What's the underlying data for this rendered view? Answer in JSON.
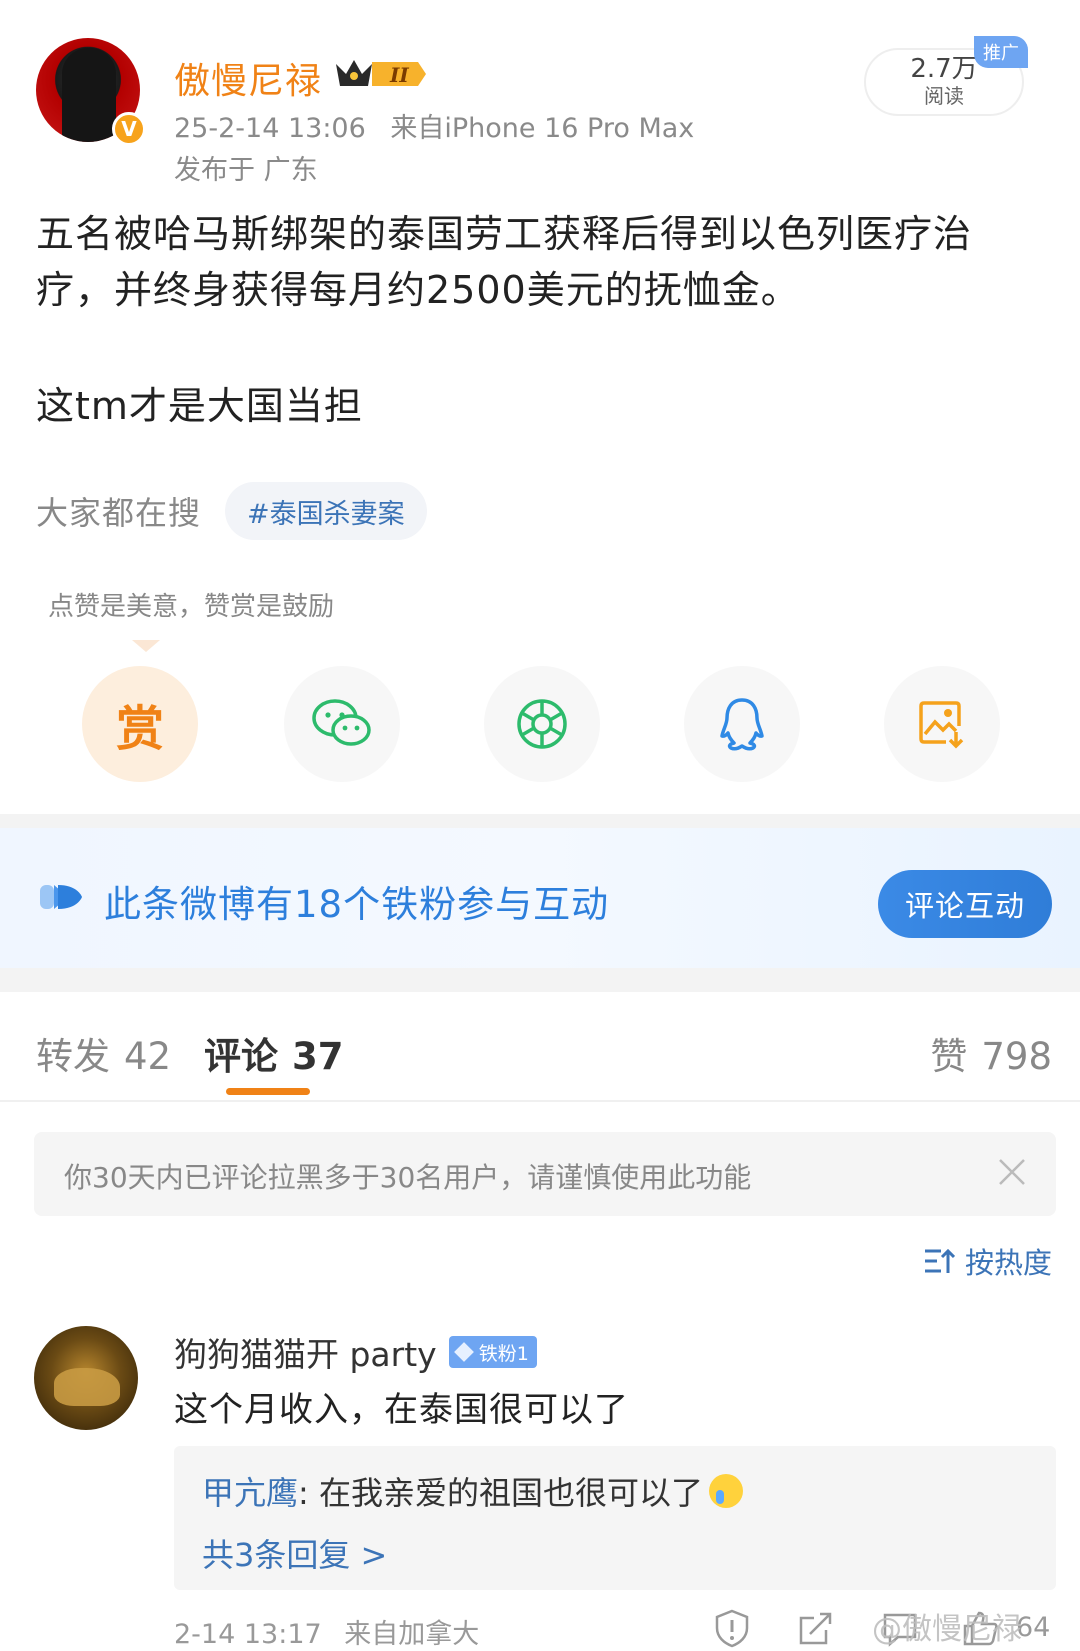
{
  "post": {
    "author": "傲慢尼禄",
    "verified_badge": "V",
    "crown_level": "II",
    "time": "25-2-14 13:06",
    "source": "来自iPhone 16 Pro Max",
    "location": "发布于 广东",
    "reads_count": "2.7万",
    "reads_label": "阅读",
    "promo_tag": "推广",
    "text_line1": "五名被哈马斯绑架的泰国劳工获释后得到以色列医疗治疗，并终身获得每月约2500美元的抚恤金。",
    "text_line2": "这tm才是大国当担"
  },
  "search": {
    "label": "大家都在搜",
    "topic": "#泰国杀妻案"
  },
  "share": {
    "note": "点赞是美意，赞赏是鼓励",
    "reward_label": "赏",
    "buttons": [
      "reward-icon",
      "wechat-icon",
      "moments-icon",
      "qq-icon",
      "save-image-icon"
    ]
  },
  "fans_banner": {
    "text": "此条微博有18个铁粉参与互动",
    "cta": "评论互动"
  },
  "tabs": {
    "repost_label": "转发",
    "repost_count": "42",
    "comment_label": "评论",
    "comment_count": "37",
    "like_label": "赞",
    "like_count": "798"
  },
  "notice": {
    "text": "你30天内已评论拉黑多于30名用户，请谨慎使用此功能"
  },
  "sort": {
    "label": "按热度"
  },
  "comment": {
    "author": "狗狗猫猫开 party",
    "fan_badge": "铁粉1",
    "text": "这个月收入，在泰国很可以了",
    "reply_author": "甲亢鹰",
    "reply_text": ": 在我亲爱的祖国也很可以了",
    "reply_more": "共3条回复 >",
    "time": "2-14 13:17",
    "source": "来自加拿大",
    "like_count": "64"
  },
  "watermark": "@傲慢尼禄",
  "colors": {
    "accent_orange": "#f08216",
    "link_blue": "#3c74b7",
    "banner_blue": "#2d7fdc"
  }
}
